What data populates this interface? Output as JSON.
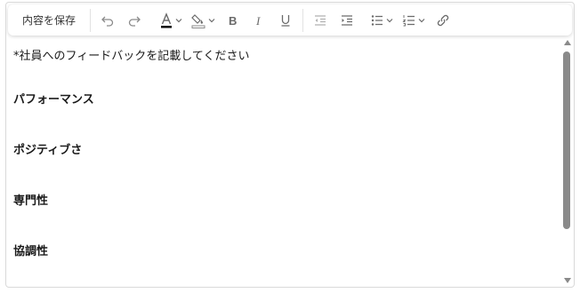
{
  "toolbar": {
    "save_label": "内容を保存",
    "buttons": [
      {
        "name": "undo",
        "icon": "undo-icon"
      },
      {
        "name": "redo",
        "icon": "redo-icon"
      },
      {
        "name": "text-color",
        "icon": "font-color-icon"
      },
      {
        "name": "highlight",
        "icon": "highlighter-icon"
      },
      {
        "name": "bold",
        "icon": "bold-icon"
      },
      {
        "name": "italic",
        "icon": "italic-icon"
      },
      {
        "name": "underline",
        "icon": "underline-icon"
      },
      {
        "name": "outdent",
        "icon": "outdent-icon"
      },
      {
        "name": "indent",
        "icon": "indent-icon"
      },
      {
        "name": "bullet-list",
        "icon": "bullet-list-icon"
      },
      {
        "name": "numbered-list",
        "icon": "numbered-list-icon"
      },
      {
        "name": "link",
        "icon": "link-icon"
      }
    ],
    "text_color": "#000000"
  },
  "content": {
    "hint": "*社員へのフィードバックを記載してください",
    "headings": [
      "パフォーマンス",
      "ポジティブさ",
      "専門性",
      "協調性"
    ]
  }
}
